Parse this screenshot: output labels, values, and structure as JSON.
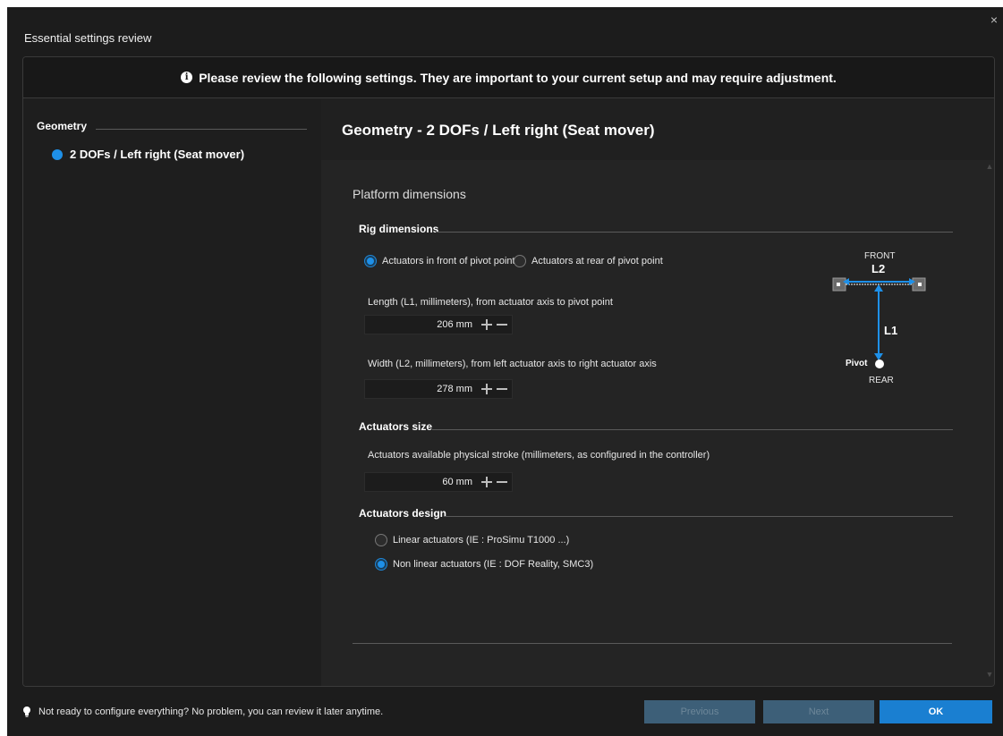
{
  "dialog": {
    "title": "Essential settings review",
    "close_label": "×"
  },
  "banner": {
    "icon": "info-icon",
    "text": "Please review the following settings. They are important to your current setup and may require adjustment."
  },
  "sidebar": {
    "heading": "Geometry",
    "items": [
      {
        "label": "2 DOFs / Left right (Seat mover)",
        "dot_color": "#1e90e8"
      }
    ]
  },
  "main": {
    "title": "Geometry  -  2 DOFs / Left right (Seat mover)",
    "section_title": "Platform dimensions",
    "rig": {
      "label": "Rig dimensions",
      "options": [
        {
          "label": "Actuators in front of pivot point",
          "selected": true
        },
        {
          "label": "Actuators at rear of pivot point",
          "selected": false
        }
      ],
      "length_label": "Length (L1, millimeters), from actuator axis to pivot point",
      "length_value": "206 mm",
      "width_label": "Width (L2, millimeters), from left actuator axis to right actuator axis",
      "width_value": "278 mm"
    },
    "actuators_size": {
      "label": "Actuators size",
      "stroke_label": "Actuators available physical stroke (millimeters, as configured in the controller)",
      "stroke_value": "60 mm"
    },
    "actuators_design": {
      "label": "Actuators design",
      "options": [
        {
          "label": "Linear actuators (IE : ProSimu T1000 ...)",
          "selected": false
        },
        {
          "label": "Non linear actuators (IE : DOF Reality, SMC3)",
          "selected": true
        }
      ]
    },
    "diagram": {
      "front": "FRONT",
      "rear": "REAR",
      "l1": "L1",
      "l2": "L2",
      "pivot": "Pivot",
      "arrow_color": "#1e90e8"
    }
  },
  "footer": {
    "tip": "Not ready to configure everything? No problem, you can review it later anytime.",
    "previous": "Previous",
    "next": "Next",
    "ok": "OK"
  }
}
